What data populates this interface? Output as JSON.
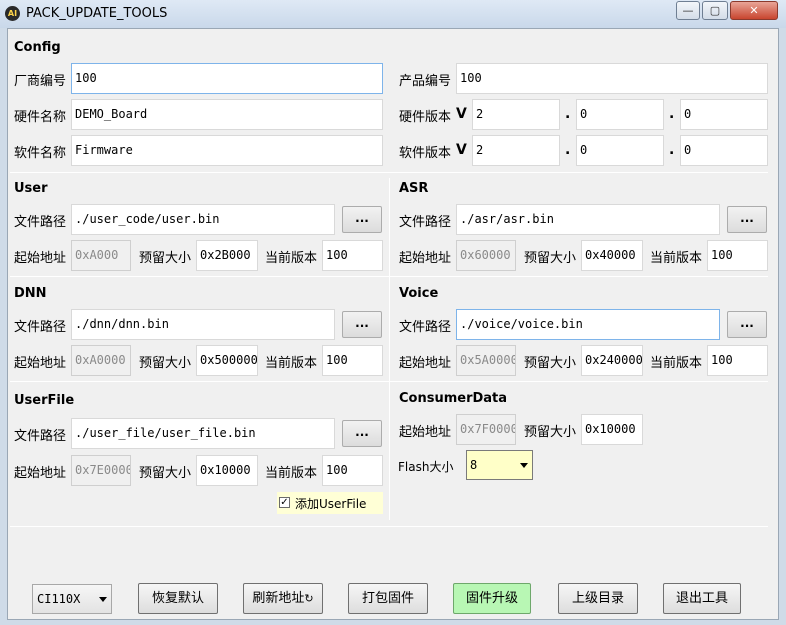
{
  "window": {
    "title": "PACK_UPDATE_TOOLS",
    "app_icon": "AI",
    "minimize": "—",
    "maximize": "▢",
    "close": "✕"
  },
  "config": {
    "header": "Config",
    "vendor_label": "厂商编号",
    "vendor_value": "100",
    "product_label": "产品编号",
    "product_value": "100",
    "hw_name_label": "硬件名称",
    "hw_name_value": "DEMO_Board",
    "hw_ver_label": "硬件版本",
    "hw_ver_v": "V",
    "hw_ver": [
      "2",
      "0",
      "0"
    ],
    "sw_name_label": "软件名称",
    "sw_name_value": "Firmware",
    "sw_ver_label": "软件版本",
    "sw_ver_v": "V",
    "sw_ver": [
      "2",
      "0",
      "0"
    ],
    "dot": "."
  },
  "labels": {
    "path": "文件路径",
    "start": "起始地址",
    "reserve": "预留大小",
    "current": "当前版本",
    "browse": "..."
  },
  "user": {
    "header": "User",
    "path": "./user_code/user.bin",
    "start": "0xA000",
    "reserve": "0x2B000",
    "current": "100"
  },
  "asr": {
    "header": "ASR",
    "path": "./asr/asr.bin",
    "start": "0x60000",
    "reserve": "0x40000",
    "current": "100"
  },
  "dnn": {
    "header": "DNN",
    "path": "./dnn/dnn.bin",
    "start": "0xA0000",
    "reserve": "0x500000",
    "current": "100"
  },
  "voice": {
    "header": "Voice",
    "path": "./voice/voice.bin",
    "start": "0x5A0000",
    "reserve": "0x240000",
    "current": "100"
  },
  "userfile": {
    "header": "UserFile",
    "path": "./user_file/user_file.bin",
    "start": "0x7E0000",
    "reserve": "0x10000",
    "current": "100",
    "checkbox_label": "添加UserFile",
    "checked": true
  },
  "consumer": {
    "header": "ConsumerData",
    "start": "0x7F0000",
    "reserve": "0x10000",
    "flash_label": "Flash大小",
    "flash_value": "8"
  },
  "bottom": {
    "chip_value": "CI110X",
    "restore_label": "恢复默认",
    "refresh_label": "刷新地址",
    "pack_label": "打包固件",
    "upgrade_label": "固件升级",
    "parent_label": "上级目录",
    "exit_label": "退出工具"
  },
  "colors": {
    "upgrade_button": "#b8f7b4",
    "flash_select": "#ffffc8",
    "focus_border": "#7eb4ea"
  }
}
